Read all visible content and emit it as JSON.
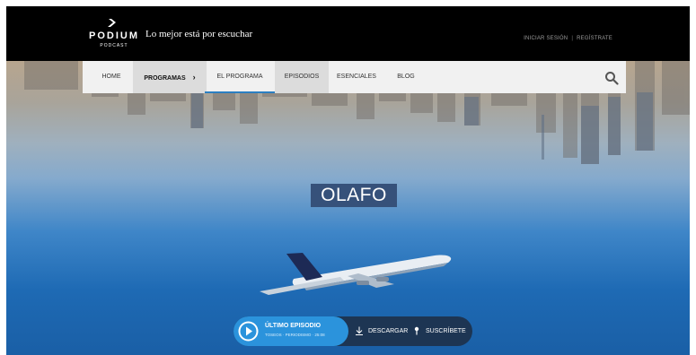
{
  "header": {
    "logo_word": "PODIUM",
    "logo_sub": "PODCAST",
    "tagline": "Lo mejor está por escuchar",
    "login": "INICIAR SESIÓN",
    "separator": "|",
    "register": "REGÍSTRATE"
  },
  "nav": {
    "items": [
      {
        "label": "HOME"
      },
      {
        "label": "PROGRAMAS"
      },
      {
        "label": "EL PROGRAMA"
      },
      {
        "label": "EPISODIOS"
      },
      {
        "label": "ESENCIALES"
      },
      {
        "label": "BLOG"
      }
    ],
    "chevron": "›",
    "active": "EL PROGRAMA"
  },
  "hero": {
    "title": "OLAFO"
  },
  "player": {
    "label": "ÚLTIMO EPISODIO",
    "meta": "TOSEOS · PERIODISMO · 25:08",
    "download": "DESCARGAR",
    "subscribe": "SUSCRÍBETE"
  },
  "colors": {
    "accent": "#2b93dc",
    "nav_underline": "#2c7fc1",
    "title_bg": "#36517a",
    "player_bg": "#1d3553",
    "topbar": "#000000"
  },
  "icons": [
    "podium-logo-icon",
    "search-icon",
    "play-icon",
    "download-icon",
    "subscribe-icon"
  ]
}
